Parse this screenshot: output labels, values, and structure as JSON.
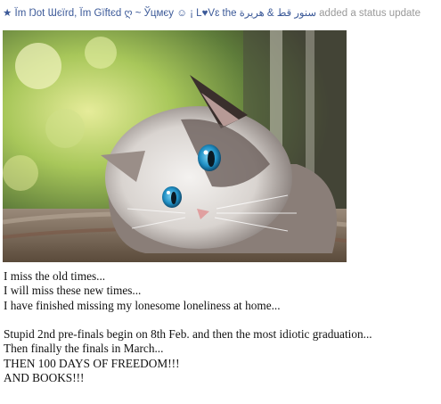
{
  "post": {
    "author": "★ Ïm Ŋot Ɯєïrd, Ïm Gïftєd ღ ~ Ўцмєу ☺ ¡ L♥Vɛ the سنور قط & هريرة",
    "action": " added a status update",
    "photo_icon": "kitten-photo",
    "lines": [
      "I miss the old times...",
      "I will miss these new times...",
      "I have finished missing my lonesome loneliness at home...",
      "",
      "Stupid 2nd pre-finals begin on 8th Feb. and then the most idiotic graduation...",
      "Then finally the finals in March...",
      "THEN 100 DAYS OF FREEDOM!!!",
      "AND BOOKS!!!"
    ]
  },
  "colors": {
    "author_link": "#3b5998",
    "action_text": "#999999"
  }
}
